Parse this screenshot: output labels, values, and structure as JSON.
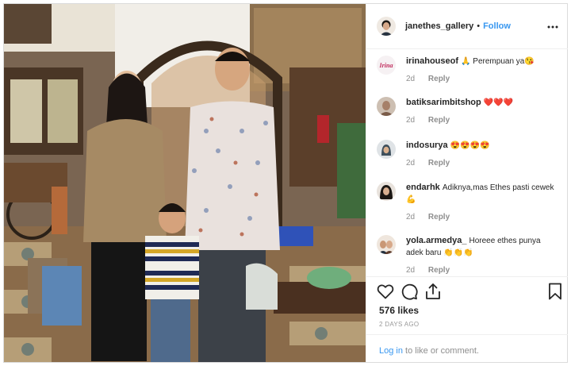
{
  "header": {
    "username": "janethes_gallery",
    "dot": "•",
    "follow_label": "Follow",
    "more_icon": "more-options-icon"
  },
  "comments": [
    {
      "user": "irinahouseof",
      "text": "🙏 Perempuan ya😘",
      "time": "2d",
      "reply": "Reply",
      "avatar_logo": "Irina",
      "avatar_icon": "brand-logo-avatar"
    },
    {
      "user": "batiksarimbitshop",
      "text": "❤️❤️❤️",
      "time": "2d",
      "reply": "Reply",
      "avatar_icon": "user-avatar"
    },
    {
      "user": "indosurya",
      "text": "😍😍😍😍",
      "time": "2d",
      "reply": "Reply",
      "avatar_icon": "user-avatar"
    },
    {
      "user": "endarhk",
      "text": "Adiknya,mas Ethes pasti cewek 💪",
      "time": "2d",
      "reply": "Reply",
      "avatar_icon": "user-avatar"
    },
    {
      "user": "yola.armedya_",
      "text": "Horeee ethes punya adek baru 👏👏👏",
      "time": "2d",
      "reply": "Reply",
      "avatar_icon": "user-avatar"
    }
  ],
  "actions": {
    "like_icon": "heart-icon",
    "comment_icon": "comment-bubble-icon",
    "share_icon": "share-icon",
    "save_icon": "bookmark-icon",
    "likes": "576 likes",
    "time": "2 DAYS AGO",
    "login_link": "Log in",
    "login_rest": " to like or comment."
  },
  "colors": {
    "link_blue": "#3897f0",
    "meta_gray": "#8e8e8e",
    "border": "#dbdbdb"
  }
}
